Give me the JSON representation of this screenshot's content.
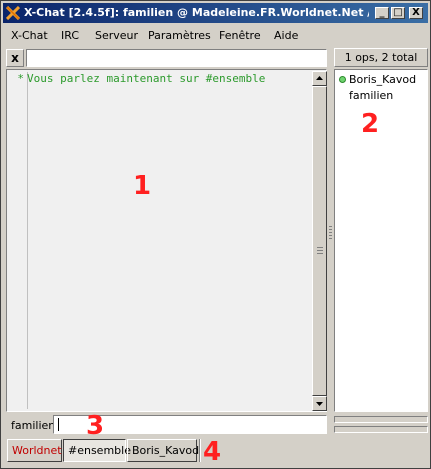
{
  "window": {
    "title": "X-Chat [2.4.5f]: familien @ Madeleine.FR.Worldnet.Net / #en...",
    "buttons": {
      "minimize": "_",
      "maximize": "□",
      "close": "X"
    }
  },
  "menu": [
    {
      "label": "X-Chat"
    },
    {
      "label": "IRC"
    },
    {
      "label": "Serveur"
    },
    {
      "label": "Paramètres"
    },
    {
      "label": "Fenêtre"
    },
    {
      "label": "Aide"
    }
  ],
  "topic": {
    "close": "x",
    "value": ""
  },
  "userlist_header": "1 ops, 2 total",
  "chat": {
    "lines": [
      {
        "prefix": "*",
        "text": "Vous parlez maintenant sur #ensemble"
      }
    ]
  },
  "users": [
    {
      "name": "Boris_Kavod",
      "op": true
    },
    {
      "name": "familien",
      "op": false
    }
  ],
  "input": {
    "nick": "familien",
    "value": ""
  },
  "tabs": [
    {
      "label": "Worldnet",
      "type": "server"
    },
    {
      "label": "#ensemble",
      "type": "channel",
      "active": true
    },
    {
      "label": "Boris_Kavod",
      "type": "query"
    }
  ],
  "annotations": [
    "1",
    "2",
    "3",
    "4"
  ],
  "colors": {
    "title_start": "#0a246a",
    "message_green": "#2c9a2c",
    "annotation_red": "#ff2020",
    "server_tab": "#c00000"
  }
}
